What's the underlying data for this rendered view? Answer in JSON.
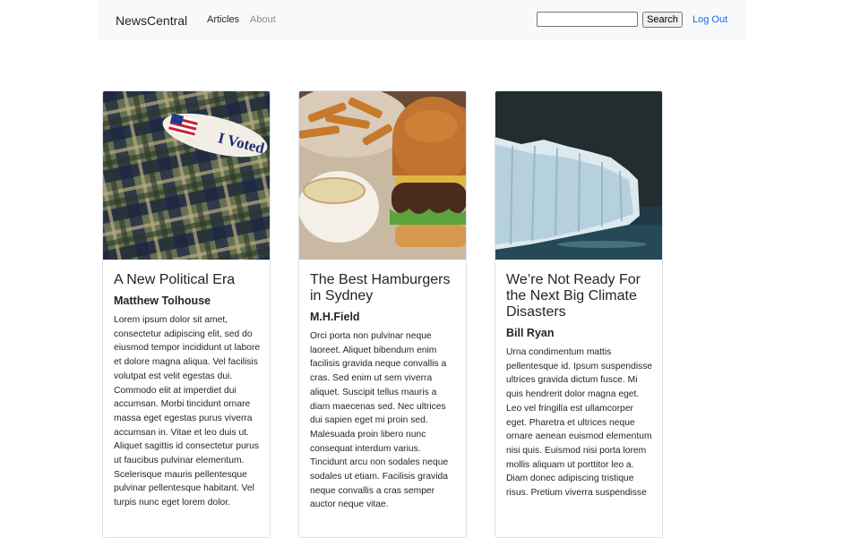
{
  "navbar": {
    "brand": "NewsCentral",
    "links": [
      "Articles",
      "About"
    ],
    "search": {
      "placeholder": "",
      "value": "",
      "button_label": "Search"
    },
    "logout_label": "Log Out"
  },
  "articles": [
    {
      "title": "A New Political Era",
      "author": "Matthew Tolhouse",
      "body": "Lorem ipsum dolor sit amet, consectetur adipiscing elit, sed do eiusmod tempor incididunt ut labore et dolore magna aliqua. Vel facilisis volutpat est velit egestas dui. Commodo elit at imperdiet dui accumsan. Morbi tincidunt ornare massa eget egestas purus viverra accumsan in. Vitae et leo duis ut. Aliquet sagittis id consectetur purus ut faucibus pulvinar elementum. Scelerisque mauris pellentesque pulvinar pellentesque habitant. Vel turpis nunc eget lorem dolor.",
      "image": "i-voted-sticker-on-plaid-fabric",
      "sticker_text": "I Voted"
    },
    {
      "title": "The Best Hamburgers in Sydney",
      "author": "M.H.Field",
      "body": "Orci porta non pulvinar neque laoreet. Aliquet bibendum enim facilisis gravida neque convallis a cras. Sed enim ut sem viverra aliquet. Suscipit tellus mauris a diam maecenas sed. Nec ultrices dui sapien eget mi proin sed. Malesuada proin libero nunc consequat interdum varius. Tincidunt arcu non sodales neque sodales ut etiam. Facilisis gravida neque convallis a cras semper auctor neque vitae.",
      "image": "burger-fries-and-dip"
    },
    {
      "title": "We’re Not Ready For the Next Big Climate Disasters",
      "author": "Bill Ryan",
      "body": "Urna condimentum mattis pellentesque id. Ipsum suspendisse ultrices gravida dictum fusce. Mi quis hendrerit dolor magna eget. Leo vel fringilla est ullamcorper eget. Pharetra et ultrices neque ornare aenean euismod elementum nisi quis. Euismod nisi porta lorem mollis aliquam ut porttitor leo a. Diam donec adipiscing tristique risus. Pretium viverra suspendisse",
      "image": "glacier-in-sea"
    }
  ]
}
